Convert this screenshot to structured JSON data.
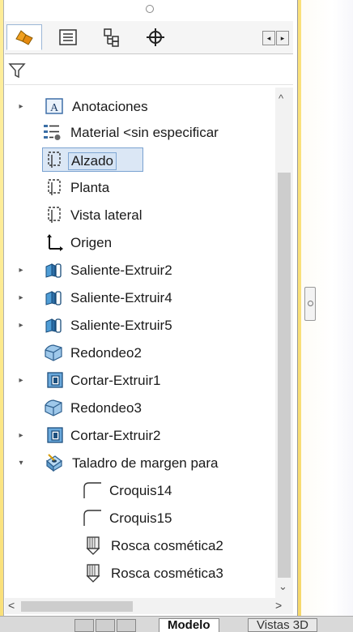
{
  "tabs": [
    {
      "icon": "feature-manager-icon",
      "active": true
    },
    {
      "icon": "property-manager-icon",
      "active": false
    },
    {
      "icon": "configuration-manager-icon",
      "active": false
    },
    {
      "icon": "dimxpert-manager-icon",
      "active": false
    }
  ],
  "tab_scroll": {
    "left": "◂",
    "right": "▸"
  },
  "filter": {
    "icon": "filter-icon"
  },
  "tree": {
    "items": [
      {
        "label": "Anotaciones",
        "icon": "annotations-icon",
        "expandable": true,
        "expanded": false,
        "level": 0
      },
      {
        "label": "Material <sin especificar",
        "icon": "material-icon",
        "expandable": false,
        "level": 0
      },
      {
        "label": "Alzado",
        "icon": "plane-icon",
        "expandable": false,
        "level": 0,
        "selected": true
      },
      {
        "label": "Planta",
        "icon": "plane-icon",
        "expandable": false,
        "level": 0
      },
      {
        "label": "Vista lateral",
        "icon": "plane-icon",
        "expandable": false,
        "level": 0
      },
      {
        "label": "Origen",
        "icon": "origin-icon",
        "expandable": false,
        "level": 0
      },
      {
        "label": "Saliente-Extruir2",
        "icon": "boss-extrude-icon",
        "expandable": true,
        "expanded": false,
        "level": 0
      },
      {
        "label": "Saliente-Extruir4",
        "icon": "boss-extrude-icon",
        "expandable": true,
        "expanded": false,
        "level": 0
      },
      {
        "label": "Saliente-Extruir5",
        "icon": "boss-extrude-icon",
        "expandable": true,
        "expanded": false,
        "level": 0
      },
      {
        "label": "Redondeo2",
        "icon": "fillet-icon",
        "expandable": false,
        "level": 0
      },
      {
        "label": "Cortar-Extruir1",
        "icon": "cut-extrude-icon",
        "expandable": true,
        "expanded": false,
        "level": 0
      },
      {
        "label": "Redondeo3",
        "icon": "fillet-icon",
        "expandable": false,
        "level": 0
      },
      {
        "label": "Cortar-Extruir2",
        "icon": "cut-extrude-icon",
        "expandable": true,
        "expanded": false,
        "level": 0
      },
      {
        "label": "Taladro de margen para",
        "icon": "hole-wizard-icon",
        "expandable": true,
        "expanded": true,
        "level": 0
      },
      {
        "label": "Croquis14",
        "icon": "sketch-icon",
        "expandable": false,
        "level": 1
      },
      {
        "label": "Croquis15",
        "icon": "sketch-icon",
        "expandable": false,
        "level": 1
      },
      {
        "label": "Rosca cosmética2",
        "icon": "cosmetic-thread-icon",
        "expandable": false,
        "level": 1
      },
      {
        "label": "Rosca cosmética3",
        "icon": "cosmetic-thread-icon",
        "expandable": false,
        "level": 1
      }
    ]
  },
  "scrollbars": {
    "up": "^",
    "down": "⌄",
    "left": "<",
    "right": ">"
  },
  "bottom_tabs": [
    {
      "label": "Modelo",
      "active": true
    },
    {
      "label": "Vistas 3D",
      "active": false
    }
  ],
  "colors": {
    "selection": "#d4e3f4",
    "selection_border": "#7fa6d3",
    "background_accent": "#fde98a"
  }
}
